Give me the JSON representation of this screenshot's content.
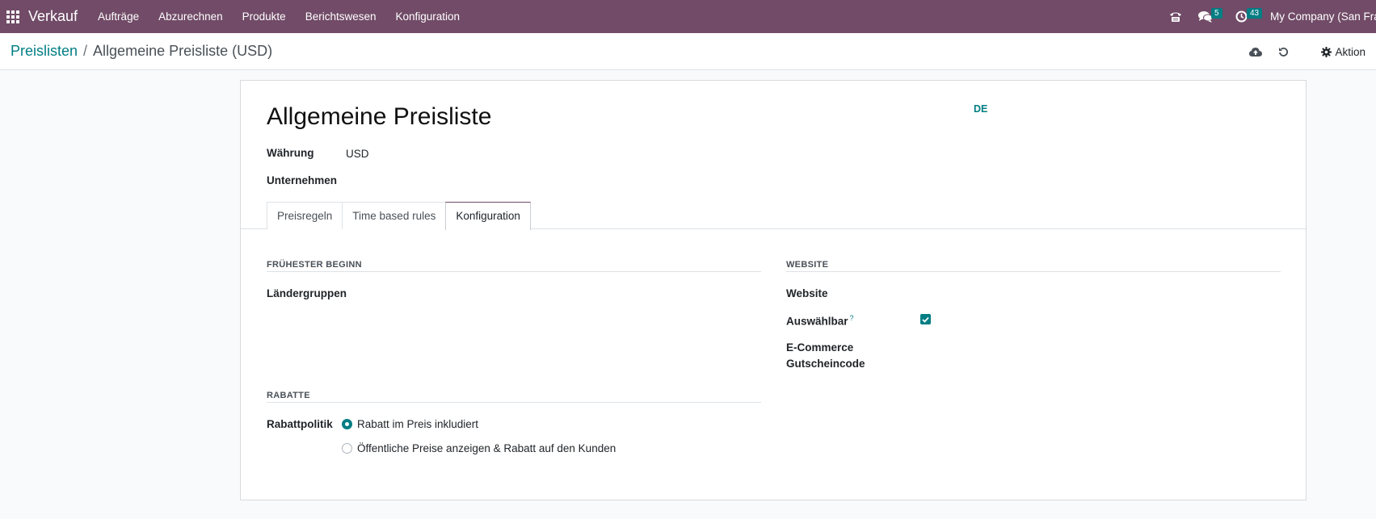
{
  "navbar": {
    "app_name": "Verkauf",
    "menu": [
      "Aufträge",
      "Abzurechnen",
      "Produkte",
      "Berichtswesen",
      "Konfiguration"
    ],
    "messages_count": "5",
    "activities_count": "43",
    "company": "My Company (San Francisco)",
    "icons": {
      "apps": "apps-grid-icon",
      "phone": "phone-icon",
      "chat": "chat-icon",
      "activity": "clock-icon"
    },
    "bg_color": "#714b67"
  },
  "breadcrumb": {
    "parent": "Preislisten",
    "separator": "/",
    "current": "Allgemeine Preisliste (USD)"
  },
  "control": {
    "action_label": "Aktion",
    "icons": {
      "save": "cloud-upload-icon",
      "discard": "undo-icon",
      "action": "gear-icon"
    }
  },
  "form": {
    "title": "Allgemeine Preisliste",
    "language": "DE",
    "currency_label": "Währung",
    "currency_value": "USD",
    "company_label": "Unternehmen",
    "company_value": ""
  },
  "tabs": [
    {
      "label": "Preisregeln",
      "active": false
    },
    {
      "label": "Time based rules",
      "active": false
    },
    {
      "label": "Konfiguration",
      "active": true
    }
  ],
  "config": {
    "availability_title": "FRÜHESTER BEGINN",
    "country_groups_label": "Ländergruppen",
    "discounts_title": "RABATTE",
    "discount_policy_label": "Rabattpolitik",
    "discount_options": [
      {
        "label": "Rabatt im Preis inkludiert",
        "selected": true
      },
      {
        "label": "Öffentliche Preise anzeigen & Rabatt auf den Kunden",
        "selected": false
      }
    ],
    "website_title": "WEBSITE",
    "website_label": "Website",
    "selectable_label": "Auswählbar",
    "selectable_help": "?",
    "selectable_checked": true,
    "ecommerce_label_line1": "E-Commerce",
    "ecommerce_label_line2": "Gutscheincode"
  },
  "colors": {
    "accent": "#017e84",
    "brand": "#714b67"
  }
}
